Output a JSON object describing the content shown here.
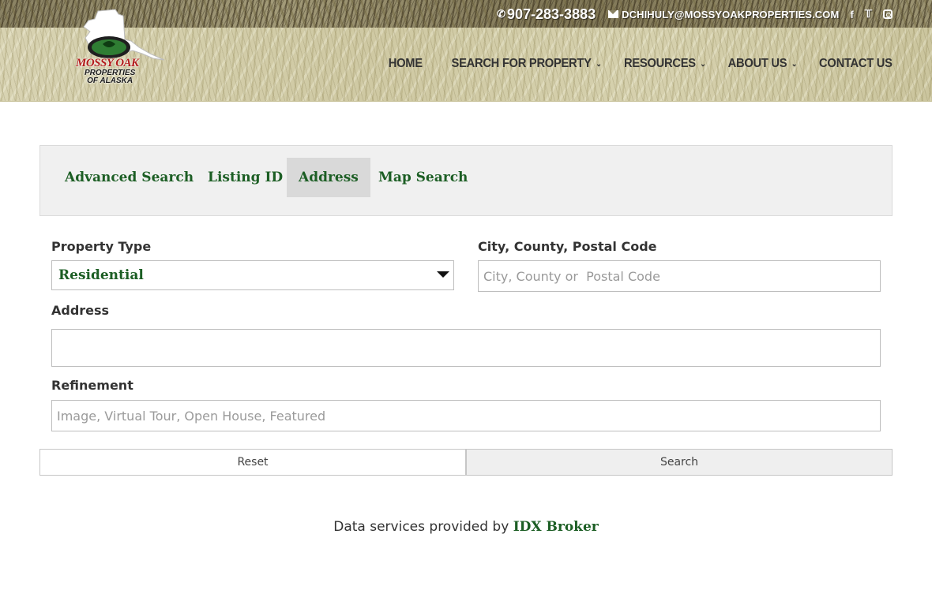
{
  "topbar": {
    "phone": "907-283-3883",
    "email": "DCHIHULY@MOSSYOAKPROPERTIES.COM",
    "social": [
      "facebook-icon",
      "twitter-icon",
      "instagram-icon"
    ]
  },
  "logo": {
    "line1": "MOSSY OAK",
    "line2": "PROPERTIES",
    "line3": "OF ALASKA"
  },
  "nav": {
    "items": [
      {
        "label": "HOME",
        "has_dropdown": false
      },
      {
        "label": "SEARCH FOR PROPERTY",
        "has_dropdown": true
      },
      {
        "label": "RESOURCES",
        "has_dropdown": true
      },
      {
        "label": "ABOUT US",
        "has_dropdown": true
      },
      {
        "label": "CONTACT US",
        "has_dropdown": false
      }
    ]
  },
  "tabs": [
    {
      "label": "Advanced Search",
      "active": false
    },
    {
      "label": "Listing ID",
      "active": false
    },
    {
      "label": "Address",
      "active": true
    },
    {
      "label": "Map Search",
      "active": false
    }
  ],
  "form": {
    "property_type": {
      "label": "Property Type",
      "value": "Residential"
    },
    "city": {
      "label": "City, County, Postal Code",
      "placeholder": "City, County or  Postal Code",
      "value": ""
    },
    "address": {
      "label": "Address",
      "placeholder": "",
      "value": ""
    },
    "refinement": {
      "label": "Refinement",
      "placeholder": "Image, Virtual Tour, Open House, Featured",
      "value": ""
    },
    "reset_label": "Reset",
    "search_label": "Search"
  },
  "footer": {
    "credit_prefix": "Data services provided by ",
    "credit_link": "IDX Broker"
  },
  "colors": {
    "brand_green": "#1c5e24",
    "logo_red": "#b31b1b"
  }
}
